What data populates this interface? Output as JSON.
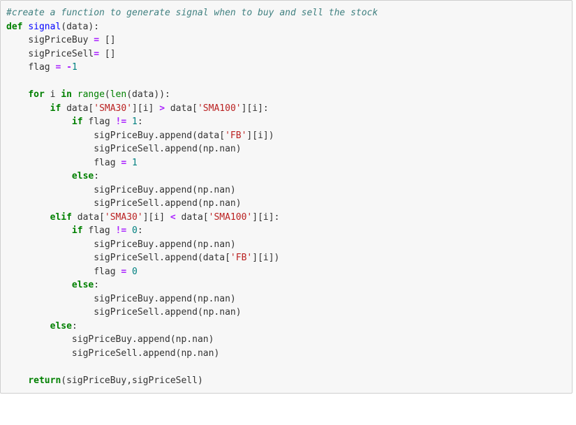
{
  "code": {
    "comment": "#create a function to generate signal when to buy and sell the stock",
    "kw_def": "def",
    "fn_name": "signal",
    "param": "data",
    "var_sigBuy": "sigPriceBuy",
    "var_sigSell": "sigPriceSell",
    "var_flag": "flag",
    "op_eq": "=",
    "lit_empty": "[]",
    "lit_neg1": "-1",
    "kw_for": "for",
    "var_i": "i",
    "kw_in": "in",
    "fn_range": "range",
    "fn_len": "len",
    "kw_if": "if",
    "kw_elif": "elif",
    "kw_else": "else",
    "col_data": "data",
    "str_SMA30": "'SMA30'",
    "str_SMA100": "'SMA100'",
    "str_FB": "'FB'",
    "op_gt": ">",
    "op_lt": "<",
    "op_ne": "!=",
    "lit_1": "1",
    "lit_0": "0",
    "meth_append": ".append",
    "np_nan": "np.nan",
    "kw_return": "return",
    "paren_open": "(",
    "paren_close": ")",
    "bracket_open": "[",
    "bracket_close": "]",
    "comma": ",",
    "colon": ":",
    "sigSellSp": "sigPriceSell"
  }
}
